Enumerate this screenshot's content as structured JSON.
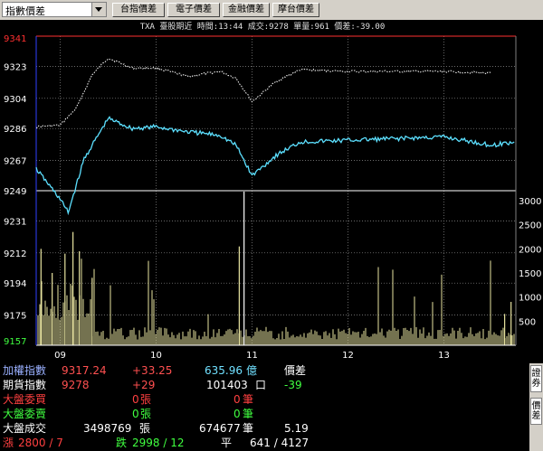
{
  "toolbar": {
    "select_value": "指數價差",
    "buttons": [
      "台指價差",
      "電子價差",
      "金融價差",
      "摩台價差"
    ]
  },
  "chart": {
    "header": "TXA 臺股期近 時間:13:44 成交:9278 單量:961 價差:-39.00",
    "price_ticks": [
      "9341",
      "9323",
      "9304",
      "9286",
      "9267",
      "9249",
      "9231",
      "9212",
      "9194",
      "9175",
      "9157"
    ],
    "volume_ticks": [
      "3000",
      "2500",
      "2000",
      "1500",
      "1000",
      "500"
    ],
    "time_ticks": [
      "09",
      "10",
      "11",
      "12",
      "13"
    ],
    "colors": {
      "index_line": "#ffffff",
      "futures_line": "#5ce0ff",
      "volume": "#e8e4a0",
      "grid": "#808080",
      "axis_highlight": "#ff3030"
    }
  },
  "chart_data": {
    "type": "line",
    "title": "TXA 臺股期近",
    "y_range": [
      9157,
      9341
    ],
    "volume_range": [
      0,
      3000
    ],
    "x_ticks": [
      "09",
      "10",
      "11",
      "12",
      "13"
    ],
    "series": [
      {
        "name": "加權指數",
        "color": "#ffffff",
        "points": [
          [
            "08:45",
            9287
          ],
          [
            "09:00",
            9288
          ],
          [
            "09:10",
            9298
          ],
          [
            "09:20",
            9318
          ],
          [
            "09:30",
            9328
          ],
          [
            "09:45",
            9322
          ],
          [
            "10:00",
            9322
          ],
          [
            "10:20",
            9317
          ],
          [
            "10:40",
            9320
          ],
          [
            "10:50",
            9316
          ],
          [
            "11:00",
            9302
          ],
          [
            "11:15",
            9314
          ],
          [
            "11:30",
            9321
          ],
          [
            "12:00",
            9320
          ],
          [
            "12:30",
            9320
          ],
          [
            "13:00",
            9320
          ],
          [
            "13:30",
            9319
          ]
        ]
      },
      {
        "name": "期貨指數",
        "color": "#5ce0ff",
        "points": [
          [
            "08:45",
            9262
          ],
          [
            "09:00",
            9244
          ],
          [
            "09:05",
            9236
          ],
          [
            "09:15",
            9268
          ],
          [
            "09:30",
            9292
          ],
          [
            "09:45",
            9286
          ],
          [
            "10:00",
            9287
          ],
          [
            "10:20",
            9284
          ],
          [
            "10:40",
            9282
          ],
          [
            "10:50",
            9276
          ],
          [
            "11:00",
            9258
          ],
          [
            "11:15",
            9270
          ],
          [
            "11:30",
            9278
          ],
          [
            "12:00",
            9279
          ],
          [
            "12:30",
            9280
          ],
          [
            "13:00",
            9281
          ],
          [
            "13:30",
            9276
          ],
          [
            "13:44",
            9278
          ]
        ]
      }
    ]
  },
  "quotes": {
    "taiex_label": "加權指數",
    "taiex_value": "9317.24",
    "taiex_change": "+33.25",
    "taiex_amount": "635.96",
    "taiex_unit": "億",
    "spread_label": "價差",
    "futures_label": "期貨指數",
    "futures_value": "9278",
    "futures_change": "+29",
    "futures_volume": "101403",
    "futures_unit": "口",
    "spread_value": "-39",
    "buy_label": "大盤委買",
    "buy_lots": "0",
    "buy_lots_unit": "張",
    "buy_orders": "0",
    "buy_orders_unit": "筆",
    "sell_label": "大盤委賣",
    "sell_lots": "0",
    "sell_lots_unit": "張",
    "sell_orders": "0",
    "sell_orders_unit": "筆",
    "deal_label": "大盤成交",
    "deal_lots": "3498769",
    "deal_lots_unit": "張",
    "deal_orders": "674677",
    "deal_orders_unit": "筆",
    "deal_ratio": "5.19",
    "up_label": "漲",
    "up_value": "2800 / 7",
    "down_label": "跌",
    "down_value": "2998 / 12",
    "flat_label": "平",
    "flat_value": "641 / 4127"
  },
  "sidebar": {
    "tab1": "證券",
    "tab2": "價差"
  }
}
